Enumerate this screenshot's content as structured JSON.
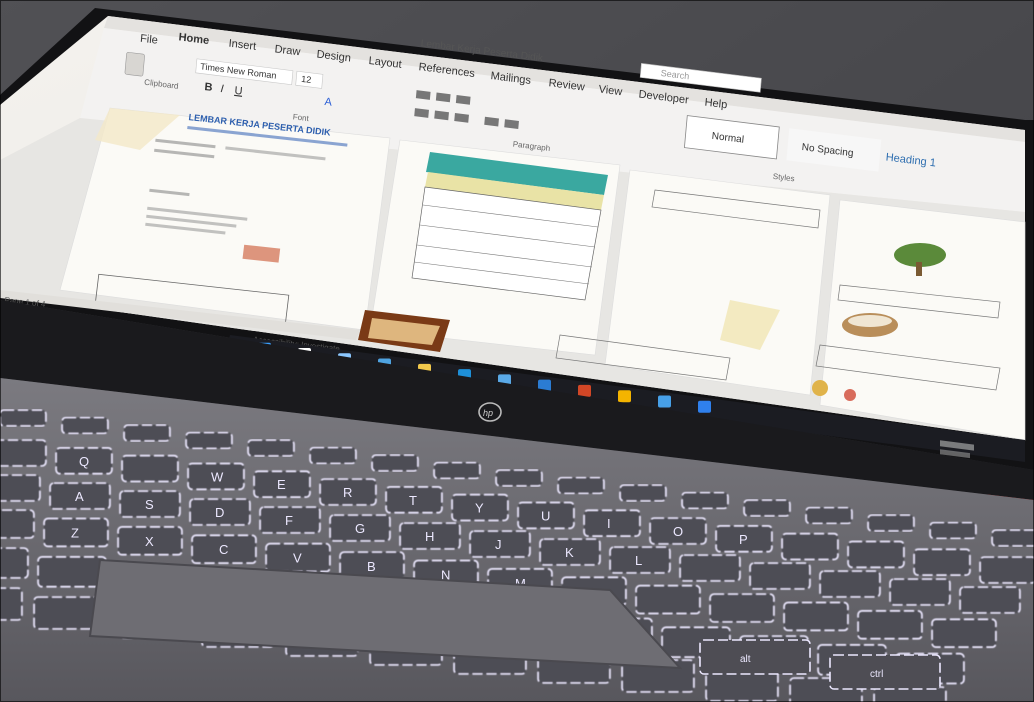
{
  "app": {
    "tabs": [
      {
        "label": "File"
      },
      {
        "label": "Home"
      },
      {
        "label": "Insert"
      },
      {
        "label": "Draw"
      },
      {
        "label": "Design"
      },
      {
        "label": "Layout"
      },
      {
        "label": "References"
      },
      {
        "label": "Mailings"
      },
      {
        "label": "Review"
      },
      {
        "label": "View"
      },
      {
        "label": "Developer"
      },
      {
        "label": "Help"
      }
    ],
    "document_title": "Lembar Kerja Peserta Didik",
    "search_placeholder": "Search",
    "font_name": "Times New Roman",
    "font_size": "12",
    "group_labels": {
      "clipboard": "Clipboard",
      "font": "Font",
      "paragraph": "Paragraph",
      "styles": "Styles"
    },
    "styles": [
      {
        "label": "Normal"
      },
      {
        "label": "No Spacing"
      },
      {
        "label": "Heading 1"
      }
    ],
    "page1": {
      "heading": "LEMBAR KERJA PESERTA DIDIK"
    }
  },
  "status_bar": {
    "page": "Page 1 of 4",
    "accessibility": "Accessibility: Investigate"
  },
  "taskbar": {
    "icons": [
      "windows-start-icon",
      "search-icon",
      "taskview-icon",
      "widgets-icon",
      "folder-icon",
      "edge-icon",
      "store-icon",
      "word-icon",
      "powerpoint-icon",
      "chrome-icon",
      "photos-icon",
      "mail-icon"
    ],
    "accent": "#0078d4"
  },
  "laptop": {
    "brand_logo": "hp",
    "keys": [
      "Q",
      "W",
      "E",
      "R",
      "T",
      "Y",
      "U",
      "I",
      "O",
      "P",
      "A",
      "S",
      "D",
      "F",
      "G",
      "H",
      "J",
      "K",
      "L",
      "Z",
      "X",
      "C",
      "V",
      "B",
      "N",
      "M",
      "alt",
      "ctrl"
    ]
  },
  "colors": {
    "key_glow": "#ece8ff",
    "chassis": "#6c6a70",
    "ribbon_bg": "#f3f2f1",
    "teal_header": "#3aa8a0"
  }
}
